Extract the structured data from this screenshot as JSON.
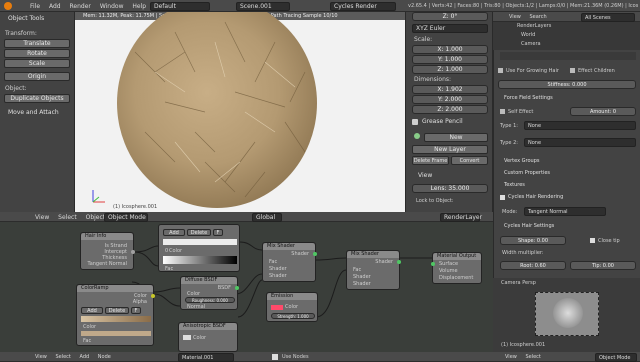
{
  "top_menu": {
    "items": [
      "File",
      "Add",
      "Render",
      "Window",
      "Help"
    ],
    "screen_layout": "Default",
    "scene": "Scene.001",
    "engine": "Cycles Render",
    "stats": "v2.65.4 | Verts:42 | Faces:80 | Tris:80 | Objects:1/2 | Lamps:0/0 | Mem:21.36M (0.26M) | Icospher"
  },
  "tools": {
    "title": "Object Tools",
    "transform_label": "Transform:",
    "buttons": [
      "Translate",
      "Rotate",
      "Scale"
    ],
    "origin": "Origin",
    "object_label": "Object:",
    "duplicate": "Duplicate Objects",
    "move_attach": "Move and Attach"
  },
  "viewport": {
    "status": "Mem: 11.32M, Peak: 11.75M | Scene.001 | Elapsed: 00:42.61 | Rendering | Path Tracing Sample 10/10",
    "object_label": "(1) Icosphere.001",
    "header_items": [
      "View",
      "Select",
      "Object"
    ],
    "mode": "Object Mode",
    "orientation": "Global",
    "render_layer": "RenderLayer"
  },
  "npanel": {
    "rot_mode": "XYZ Euler",
    "scale_label": "Scale:",
    "scale": [
      "X: 1.000",
      "Y: 1.000",
      "Z: 1.000"
    ],
    "dims_label": "Dimensions:",
    "dims": [
      "X: 1.902",
      "Y: 2.000",
      "Z: 2.000"
    ],
    "gp_title": "Grease Pencil",
    "gp_new": "New",
    "gp_new_layer": "New Layer",
    "gp_delete": "Delete Frame",
    "gp_convert": "Convert",
    "view_title": "View",
    "lens": "Lens: 35.000",
    "lock": "Lock to Object:"
  },
  "outliner": {
    "header": [
      "View",
      "Search",
      "All Scenes"
    ],
    "items": [
      "RenderLayers",
      "World",
      "Camera"
    ]
  },
  "props": {
    "use_growing": "Use For Growing Hair",
    "effect_children": "Effect Children",
    "stiffness": "Stiffness: 0.000",
    "force_title": "Force Field Settings",
    "self_effect": "Self Effect",
    "amount": "Amount: 0",
    "type1_label": "Type 1:",
    "type1": "None",
    "type2_label": "Type 2:",
    "type2": "None",
    "vertex_groups": "Vertex Groups",
    "custom_props": "Custom Properties",
    "textures": "Textures",
    "cycles_hair_render": "Cycles Hair Rendering",
    "mode_label": "Mode:",
    "mode_value": "Tangent Normal",
    "cycles_hair_settings": "Cycles Hair Settings",
    "shape": "Shape: 0.00",
    "close_tip": "Close tip",
    "width_label": "Width multiplier:",
    "root": "Root: 0.60",
    "tip": "Tip: 0.00"
  },
  "camera_preview": {
    "title": "Camera Persp",
    "label": "(1) Icosphere.001",
    "header": [
      "View",
      "Select"
    ],
    "mode": "Object Mode"
  },
  "node_editor": {
    "header": [
      "View",
      "Select",
      "Add",
      "Node"
    ],
    "material": "Material.001",
    "use_nodes": "Use Nodes",
    "nodes": {
      "hairinfo": {
        "title": "Hair Info",
        "outputs": [
          "Is Strand",
          "Intercept",
          "Thickness",
          "Tangent Normal"
        ]
      },
      "ramp1": {
        "add": "Add",
        "delete": "Delete",
        "f": "F",
        "fac": "Fac",
        "pos": "0",
        "color_label": "Color"
      },
      "colorramp": {
        "title": "ColorRamp",
        "add": "Add",
        "delete": "Delete",
        "f": "F",
        "alpha": "Alpha",
        "color_label": "Color",
        "fac": "Fac"
      },
      "diffuse": {
        "title": "Diffuse BSDF",
        "color": "Color",
        "roughness": "Roughness: 0.000",
        "normal": "Normal",
        "bsdf": "BSDF"
      },
      "mix1": {
        "title": "Mix Shader",
        "fac": "Fac",
        "shader1": "Shader",
        "shader2": "Shader",
        "out": "Shader"
      },
      "mix2": {
        "title": "Mix Shader",
        "fac": "Fac",
        "shader1": "Shader",
        "shader2": "Shader",
        "out": "Shader"
      },
      "emission": {
        "title": "Emission",
        "color": "Color",
        "strength": "Strength: 1.000"
      },
      "output": {
        "title": "Material Output",
        "inputs": [
          "Surface",
          "Volume",
          "Displacement"
        ]
      },
      "aniso": {
        "title": "Anisotropic BSDF",
        "color": "Color"
      }
    }
  },
  "colors": {
    "bg": "#3d3d3d",
    "header": "#4a4a4a",
    "hair": "#b49a72",
    "node_bg": "#6b6b6b",
    "socket_shader": "#4fc763",
    "socket_color": "#c7c729",
    "socket_float": "#a0a0a0",
    "socket_vector": "#6363c7"
  }
}
